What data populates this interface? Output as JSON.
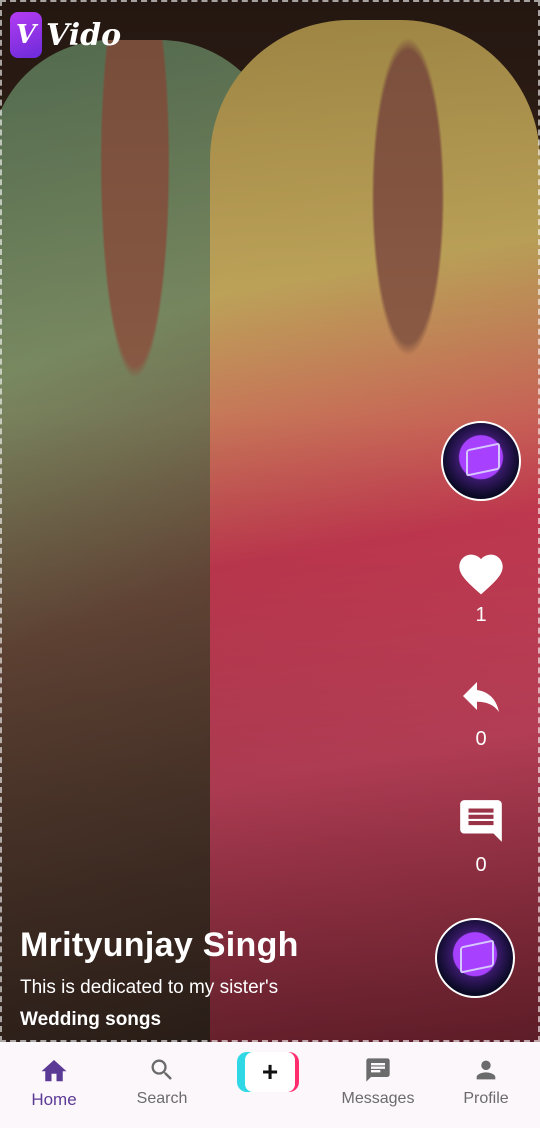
{
  "app": {
    "logo_letter": "V",
    "logo_text": "Vido"
  },
  "video": {
    "author": "Mrityunjay Singh",
    "description": "This is dedicated to my sister's",
    "tag": "Wedding songs"
  },
  "actions": {
    "like_count": "1",
    "share_count": "0",
    "comment_count": "0"
  },
  "nav": {
    "home": "Home",
    "search": "Search",
    "add": "+",
    "messages": "Messages",
    "profile": "Profile"
  },
  "colors": {
    "accent": "#5b3a96",
    "brand_gradient_start": "#b43cf2",
    "brand_gradient_end": "#6c2bd9",
    "add_button_cyan": "#2fd8e4",
    "add_button_pink": "#ff2d6e"
  }
}
